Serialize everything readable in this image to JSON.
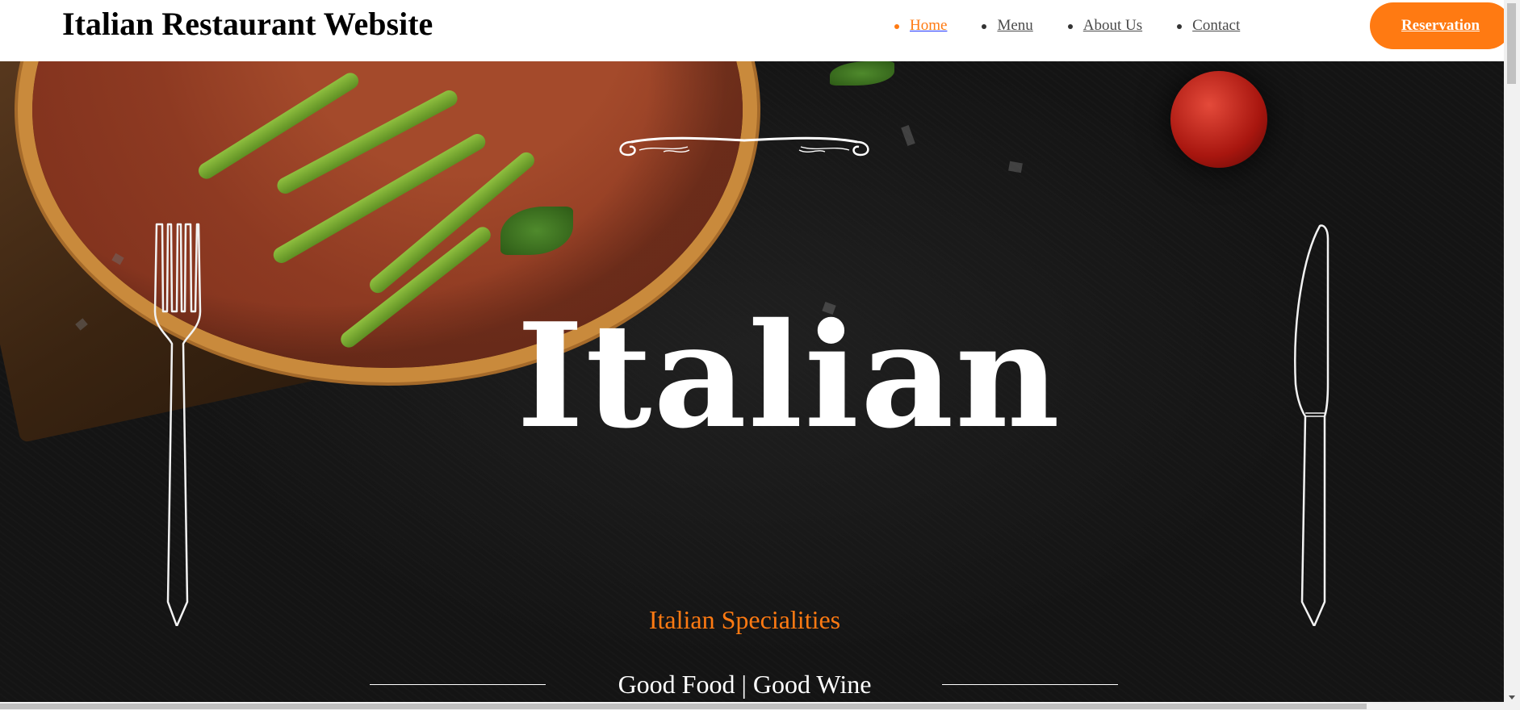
{
  "header": {
    "site_title": "Italian Restaurant Website",
    "nav": [
      {
        "label": "Home",
        "active": true
      },
      {
        "label": "Menu",
        "active": false
      },
      {
        "label": "About Us",
        "active": false
      },
      {
        "label": "Contact",
        "active": false
      }
    ],
    "reservation_label": "Reservation"
  },
  "hero": {
    "headline": "Italian",
    "subheading": "Italian Specialities",
    "tagline": "Good Food | Good Wine"
  },
  "colors": {
    "accent": "#ff7a12",
    "hero_background": "#141414",
    "text_light": "#ffffff"
  },
  "icons": [
    "fork-icon",
    "knife-icon",
    "flourish-ornament"
  ]
}
